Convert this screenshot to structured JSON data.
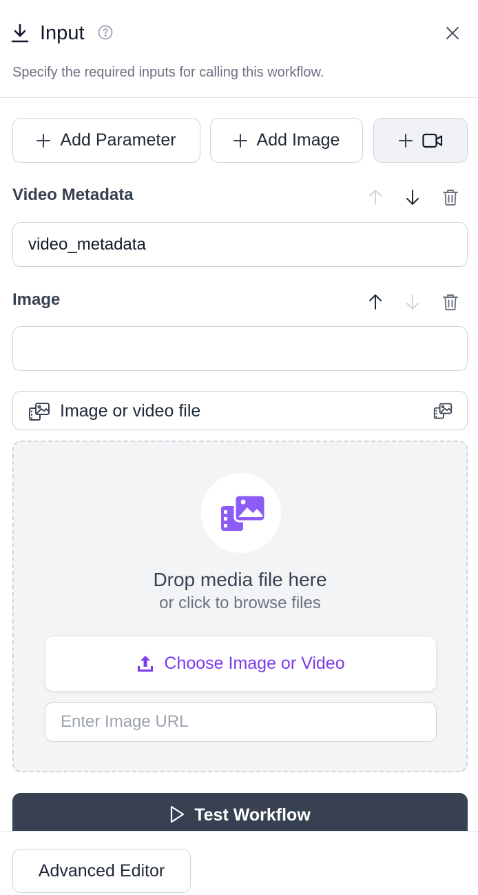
{
  "header": {
    "title": "Input",
    "subtitle": "Specify the required inputs for calling this workflow."
  },
  "toolbar": {
    "add_parameter_label": "Add Parameter",
    "add_image_label": "Add Image"
  },
  "fields": [
    {
      "label": "Video Metadata",
      "value": "video_metadata",
      "can_move_up": false,
      "can_move_down": true
    },
    {
      "label": "Image",
      "value": "",
      "can_move_up": true,
      "can_move_down": false
    }
  ],
  "media_type": {
    "selected": "Image or video file"
  },
  "dropzone": {
    "title": "Drop media file here",
    "subtitle": "or click to browse files",
    "choose_label": "Choose Image or Video",
    "url_placeholder": "Enter Image URL"
  },
  "actions": {
    "test_label": "Test Workflow",
    "advanced_label": "Advanced Editor"
  },
  "colors": {
    "accent": "#7c3aed",
    "primary_button": "#374151",
    "icon_muted": "#d1d5db"
  },
  "icons": [
    "download-icon",
    "help-circle-icon",
    "close-icon",
    "plus-icon",
    "video-icon",
    "arrow-up-icon",
    "arrow-down-icon",
    "trash-icon",
    "media-gallery-icon",
    "upload-icon",
    "play-icon"
  ]
}
